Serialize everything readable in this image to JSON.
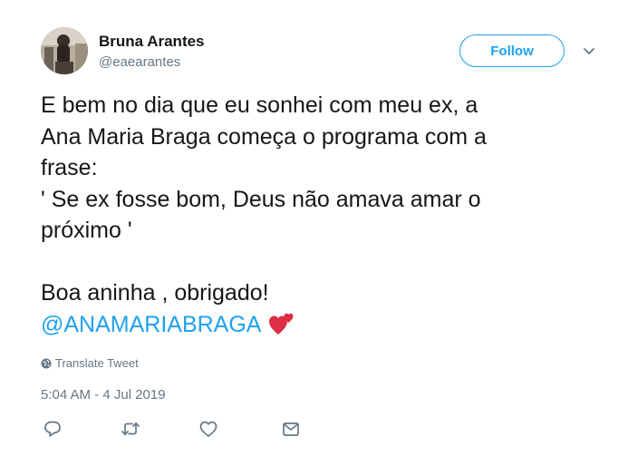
{
  "author": {
    "name": "Bruna Arantes",
    "handle": "@eaearantes"
  },
  "follow_label": "Follow",
  "tweet": {
    "lines": [
      "E bem no dia que eu sonhei com meu ex, a",
      "Ana Maria Braga começa o programa com a",
      "frase:",
      "' Se ex fosse bom, Deus não amava amar o",
      "próximo '",
      "",
      "Boa aninha , obrigado!"
    ],
    "mention": "@ANAMARIABRAGA"
  },
  "translate_label": "Translate Tweet",
  "timestamp": "5:04 AM - 4 Jul 2019",
  "colors": {
    "accent": "#1da1f2",
    "secondary_text": "#657786",
    "primary_text": "#14171a",
    "heart": "#e0245e"
  },
  "icons": {
    "caret": "chevron-down-icon",
    "translate": "globe-icon",
    "reply": "reply-icon",
    "retweet": "retweet-icon",
    "like": "like-icon",
    "message": "envelope-icon",
    "emoji": "two-hearts-emoji"
  }
}
